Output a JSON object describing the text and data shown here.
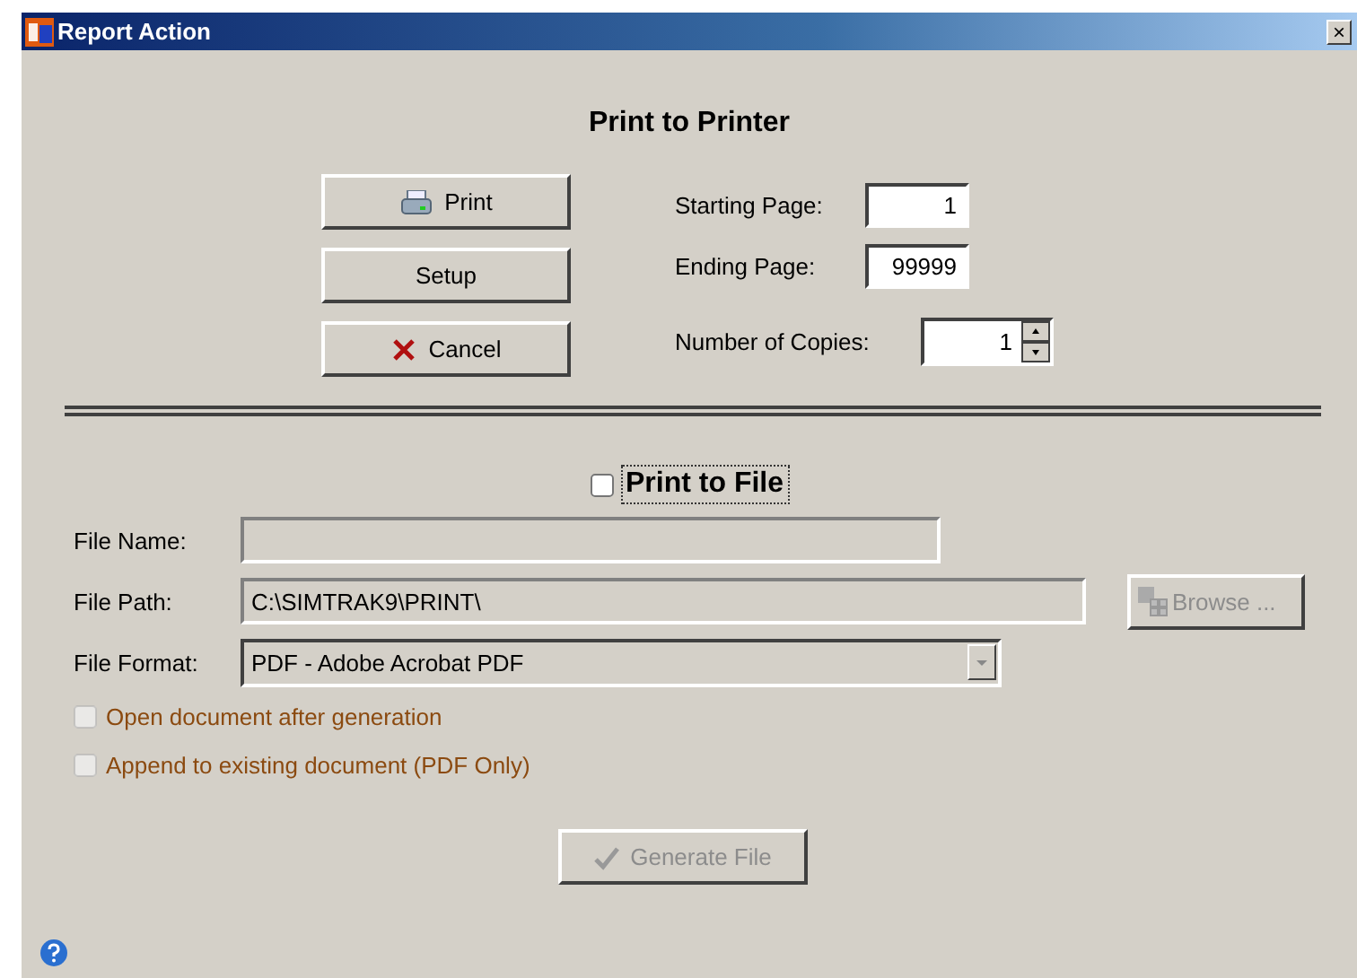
{
  "window": {
    "title": "Report Action",
    "close_label": "×"
  },
  "printer": {
    "heading": "Print to Printer",
    "buttons": [
      {
        "kind": "print",
        "label": "Print"
      },
      {
        "kind": "setup",
        "label": "Setup"
      },
      {
        "kind": "cancel",
        "label": "Cancel"
      }
    ],
    "starting_page": {
      "label": "Starting Page:",
      "value": "1"
    },
    "ending_page": {
      "label": "Ending Page:",
      "value": "99999"
    },
    "copies": {
      "label": "Number of Copies:",
      "value": "1"
    }
  },
  "print_to_file": {
    "label": "Print to File",
    "checked": false
  },
  "file": {
    "name": {
      "label": "File Name:",
      "disabled": true
    },
    "path": {
      "label": "File Path:",
      "value": "C:\\SIMTRAK9\\PRINT\\",
      "disabled": true
    },
    "browse": {
      "label": "Browse ...",
      "disabled": true
    },
    "format": {
      "label": "File Format:",
      "value": "PDF - Adobe Acrobat PDF",
      "disabled": true
    },
    "options": [
      {
        "label": "Open document after generation",
        "checked": false,
        "disabled": true
      },
      {
        "label": "Append to existing document (PDF Only)",
        "checked": false,
        "disabled": true
      }
    ],
    "generate": {
      "label": "Generate File",
      "disabled": true
    }
  }
}
